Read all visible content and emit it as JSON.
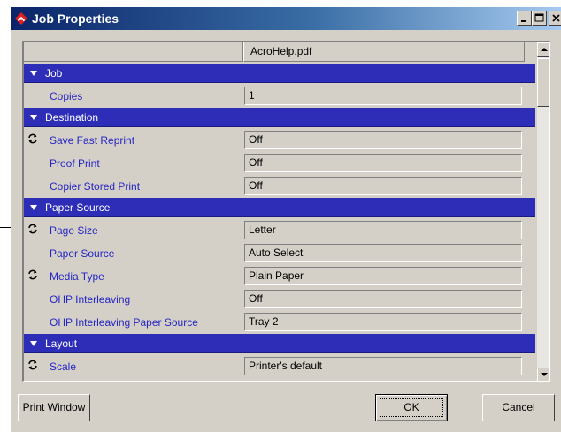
{
  "window": {
    "title": "Job Properties",
    "app_icon": "acrobat-icon",
    "controls": [
      "minimize-icon",
      "maximize-icon",
      "close-icon"
    ]
  },
  "grid": {
    "column_header": "AcroHelp.pdf",
    "sections": [
      {
        "label": "Job",
        "rows": [
          {
            "label": "Copies",
            "value": "1",
            "refresh": false
          }
        ]
      },
      {
        "label": "Destination",
        "rows": [
          {
            "label": "Save Fast Reprint",
            "value": "Off",
            "refresh": true
          },
          {
            "label": "Proof Print",
            "value": "Off",
            "refresh": false
          },
          {
            "label": "Copier Stored Print",
            "value": "Off",
            "refresh": false
          }
        ]
      },
      {
        "label": "Paper Source",
        "rows": [
          {
            "label": "Page Size",
            "value": "Letter",
            "refresh": true
          },
          {
            "label": "Paper Source",
            "value": "Auto Select",
            "refresh": false
          },
          {
            "label": "Media Type",
            "value": "Plain Paper",
            "refresh": true
          },
          {
            "label": "OHP Interleaving",
            "value": "Off",
            "refresh": false
          },
          {
            "label": "OHP Interleaving Paper Source",
            "value": "Tray 2",
            "refresh": false
          }
        ]
      },
      {
        "label": "Layout",
        "rows": [
          {
            "label": "Scale",
            "value": "Printer's default",
            "refresh": true
          }
        ]
      }
    ]
  },
  "buttons": {
    "print_window": "Print Window",
    "ok": "OK",
    "cancel": "Cancel"
  },
  "colors": {
    "section_bg": "#2d2db8",
    "label_text": "#2626c4",
    "face": "#d4d0c8"
  }
}
